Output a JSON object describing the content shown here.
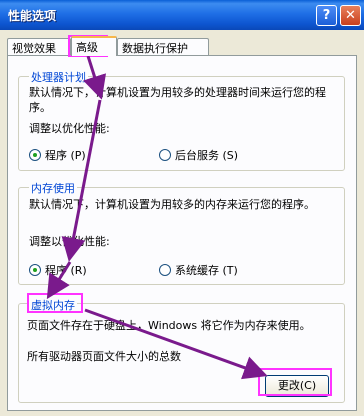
{
  "window": {
    "title": "性能选项",
    "help_label": "?",
    "close_label": "✕"
  },
  "tabs": [
    {
      "label": "视觉效果"
    },
    {
      "label": "高级"
    },
    {
      "label": "数据执行保护"
    }
  ],
  "processor": {
    "title": "处理器计划",
    "desc": "默认情况下，计算机设置为用较多的处理器时间来运行您的程序。",
    "prompt": "调整以优化性能:",
    "opt1": "程序 (P)",
    "opt2": "后台服务 (S)",
    "selected": "opt1"
  },
  "memory": {
    "title": "内存使用",
    "desc": "默认情况下，计算机设置为用较多的内存来运行您的程序。",
    "prompt": "调整以优化性能:",
    "opt1": "程序 (R)",
    "opt2": "系统缓存 (T)",
    "selected": "opt1"
  },
  "virtual_memory": {
    "title": "虚拟内存",
    "desc": "页面文件存在于硬盘上，Windows 将它作为内存来使用。",
    "total": "所有驱动器页面文件大小的总数",
    "change_button": "更改(C)"
  },
  "colors": {
    "highlight": "#ff33ff",
    "arrow": "#7a1a8c",
    "accent": "#0046d5"
  }
}
